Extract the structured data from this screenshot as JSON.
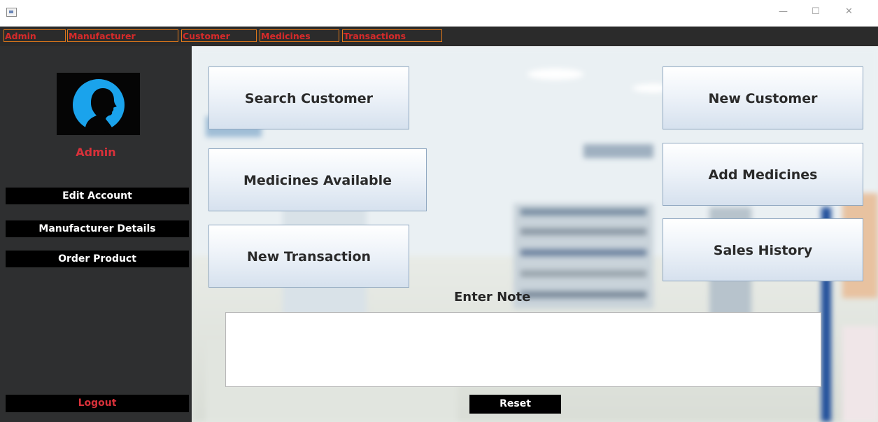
{
  "window": {
    "icon": "java-app-icon",
    "controls": {
      "minimize": "—",
      "maximize": "☐",
      "close": "✕"
    }
  },
  "menubar": {
    "items": [
      "Admin",
      "Manufacturer",
      "Customer",
      "Medicines",
      "Transactions"
    ]
  },
  "sidebar": {
    "avatar_icon": "user-silhouette-icon",
    "username": "Admin",
    "buttons": {
      "edit_account": "Edit Account",
      "manufacturer_details": "Manufacturer Details",
      "order_product": "Order Product",
      "logout": "Logout"
    }
  },
  "actions": {
    "search_customer": "Search Customer",
    "new_customer": "New Customer",
    "medicines_available": "Medicines Available",
    "add_medicines": "Add Medicines",
    "new_transaction": "New Transaction",
    "sales_history": "Sales History"
  },
  "note": {
    "label": "Enter Note",
    "value": "",
    "reset_label": "Reset"
  },
  "colors": {
    "menubar_bg": "#2b2b2b",
    "menu_text": "#d62a2a",
    "menu_border": "#e0781a",
    "sidebar_bg": "#2e2f30",
    "username": "#d8313a",
    "logout_text": "#d8313a",
    "avatar_ring": "#1aa3ec"
  }
}
